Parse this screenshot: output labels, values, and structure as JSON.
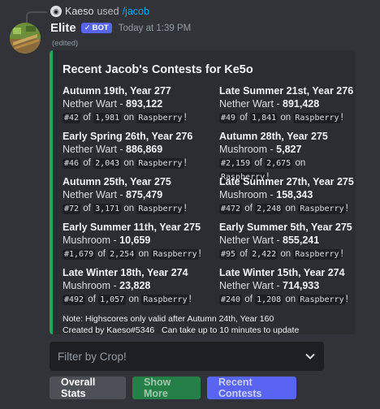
{
  "interaction": {
    "user": "Kaeso",
    "used_text": "used",
    "command": "/jacob"
  },
  "message": {
    "username": "Elite",
    "bot_badge": "BOT",
    "timestamp": "Today at 1:39 PM",
    "edited": "(edited)"
  },
  "embed": {
    "accent_color": "#23a55a",
    "title": "Recent Jacob's Contests for Ke5o",
    "contests": [
      {
        "title": "Autumn 19th, Year 277",
        "crop": "Nether Wart",
        "amount": "893,122",
        "rank": "#42",
        "total": "1,981"
      },
      {
        "title": "Late Summer 21st, Year 276",
        "crop": "Nether Wart",
        "amount": "891,428",
        "rank": "#49",
        "total": "1,841"
      },
      {
        "title": "Early Spring 26th, Year 276",
        "crop": "Nether Wart",
        "amount": "886,869",
        "rank": "#46",
        "total": "2,043"
      },
      {
        "title": "Autumn 28th, Year 275",
        "crop": "Mushroom",
        "amount": "5,827",
        "rank": "#2,159",
        "total": "2,675"
      },
      {
        "title": "Autumn 25th, Year 275",
        "crop": "Nether Wart",
        "amount": "875,479",
        "rank": "#72",
        "total": "3,171"
      },
      {
        "title": "Late Summer 27th, Year 275",
        "crop": "Mushroom",
        "amount": "158,343",
        "rank": "#472",
        "total": "2,248"
      },
      {
        "title": "Early Summer 11th, Year 275",
        "crop": "Mushroom",
        "amount": "10,659",
        "rank": "#1,679",
        "total": "2,254"
      },
      {
        "title": "Early Summer 5th, Year 275",
        "crop": "Nether Wart",
        "amount": "855,241",
        "rank": "#95",
        "total": "2,422"
      },
      {
        "title": "Late Winter 18th, Year 274",
        "crop": "Mushroom",
        "amount": "23,828",
        "rank": "#492",
        "total": "1,057"
      },
      {
        "title": "Late Winter 15th, Year 274",
        "crop": "Nether Wart",
        "amount": "714,933",
        "rank": "#240",
        "total": "1,208"
      }
    ],
    "rank_of": "of",
    "rank_on": "on",
    "profile": "Raspberry",
    "profile_suffix": "!",
    "separator": " - ",
    "note": "Note: Highscores only valid after Autumn 24th, Year 160",
    "footer": "Created by Kaeso#5346   Can take up to 10 minutes to update"
  },
  "select": {
    "placeholder": "Filter by Crop!"
  },
  "buttons": {
    "overall": "Overall Stats",
    "more": "Show More",
    "recent": "Recent Contests"
  }
}
